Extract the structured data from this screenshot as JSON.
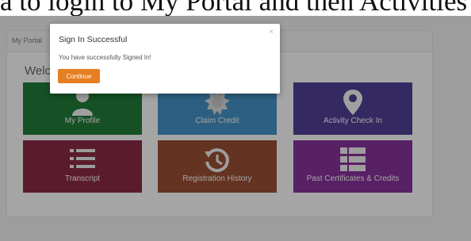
{
  "caption": "a to login to My Portal and then Activities",
  "portal": {
    "tab_label": "My Portal",
    "welcome": "Welcome"
  },
  "tiles": [
    {
      "label": "My Profile",
      "color": "#006d1c",
      "icon": "user-icon"
    },
    {
      "label": "Claim Credit",
      "color": "#2e86c1",
      "icon": "badge-icon"
    },
    {
      "label": "Activity Check In",
      "color": "#3f2d8c",
      "icon": "map-pin-icon"
    },
    {
      "label": "Transcript",
      "color": "#7d1432",
      "icon": "list-icon"
    },
    {
      "label": "Registration History",
      "color": "#8a3a1c",
      "icon": "history-icon"
    },
    {
      "label": "Past Certificates & Credits",
      "color": "#7a1a8e",
      "icon": "grid-list-icon"
    }
  ],
  "modal": {
    "title": "Sign In Successful",
    "message": "You have successfully Signed In!",
    "button_label": "Continue",
    "close_label": "×",
    "button_color": "#e67e22"
  }
}
